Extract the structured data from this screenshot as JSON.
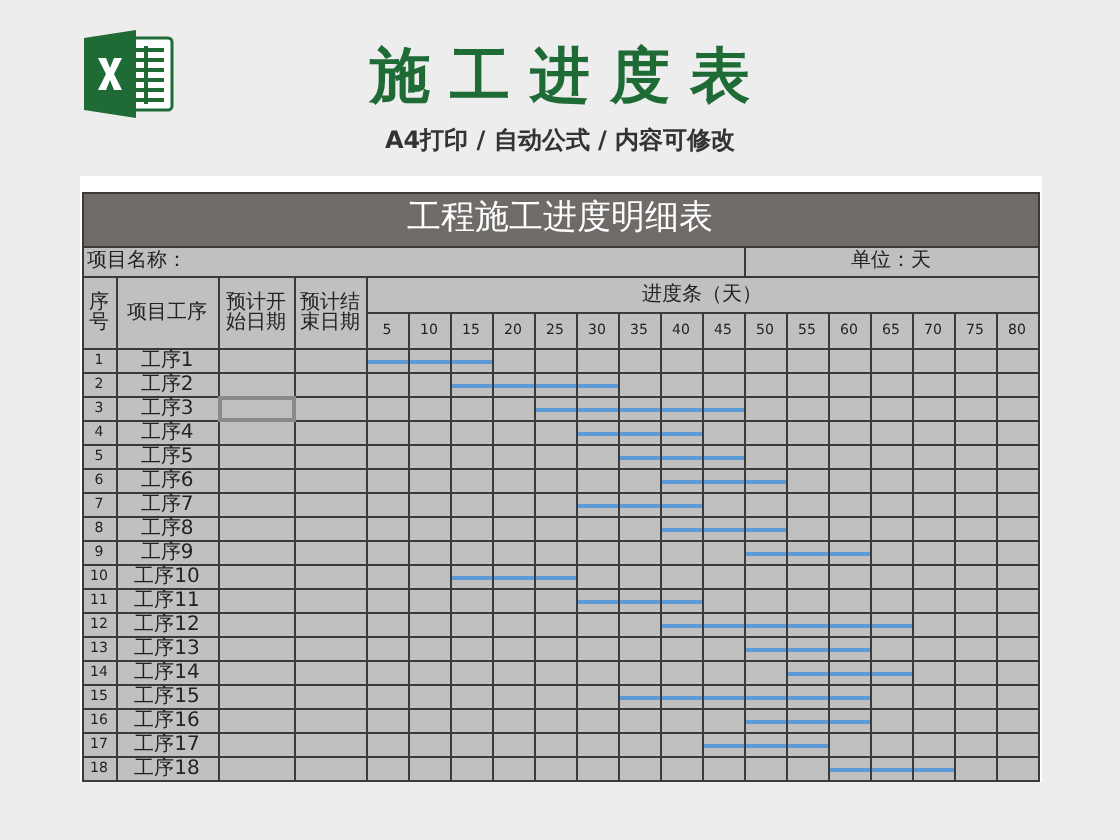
{
  "header": {
    "title": "施工进度表",
    "subtitle": "A4打印 / 自动公式 / 内容可修改"
  },
  "sheet": {
    "title": "工程施工进度明细表",
    "project_label": "项目名称：",
    "unit_label": "单位：天",
    "columns": [
      "序号",
      "项目工序",
      "预计开始日期",
      "预计结束日期"
    ],
    "progress_header": "进度条（天）",
    "day_columns": [
      "5",
      "10",
      "15",
      "20",
      "25",
      "30",
      "35",
      "40",
      "45",
      "50",
      "55",
      "60",
      "65",
      "70",
      "75",
      "80"
    ],
    "rows": [
      {
        "no": "1",
        "task": "工序1",
        "selected": false,
        "days": [
          {
            "filled": true
          },
          {
            "filled": true
          },
          {
            "filled": true
          },
          {
            "filled": false
          },
          {
            "filled": false
          },
          {
            "filled": false
          },
          {
            "filled": false
          },
          {
            "filled": false
          },
          {
            "filled": false
          },
          {
            "filled": false
          },
          {
            "filled": false
          },
          {
            "filled": false
          },
          {
            "filled": false
          },
          {
            "filled": false
          },
          {
            "filled": false
          },
          {
            "filled": false
          }
        ]
      },
      {
        "no": "2",
        "task": "工序2",
        "selected": false,
        "days": [
          {
            "filled": false
          },
          {
            "filled": false
          },
          {
            "filled": true
          },
          {
            "filled": true
          },
          {
            "filled": true
          },
          {
            "filled": true
          },
          {
            "filled": false
          },
          {
            "filled": false
          },
          {
            "filled": false
          },
          {
            "filled": false
          },
          {
            "filled": false
          },
          {
            "filled": false
          },
          {
            "filled": false
          },
          {
            "filled": false
          },
          {
            "filled": false
          },
          {
            "filled": false
          }
        ]
      },
      {
        "no": "3",
        "task": "工序3",
        "selected": true,
        "days": [
          {
            "filled": false
          },
          {
            "filled": false
          },
          {
            "filled": false
          },
          {
            "filled": false
          },
          {
            "filled": true
          },
          {
            "filled": true
          },
          {
            "filled": true
          },
          {
            "filled": true
          },
          {
            "filled": true
          },
          {
            "filled": false
          },
          {
            "filled": false
          },
          {
            "filled": false
          },
          {
            "filled": false
          },
          {
            "filled": false
          },
          {
            "filled": false
          },
          {
            "filled": false
          }
        ]
      },
      {
        "no": "4",
        "task": "工序4",
        "selected": false,
        "days": [
          {
            "filled": false
          },
          {
            "filled": false
          },
          {
            "filled": false
          },
          {
            "filled": false
          },
          {
            "filled": false
          },
          {
            "filled": true
          },
          {
            "filled": true
          },
          {
            "filled": true
          },
          {
            "filled": false
          },
          {
            "filled": false
          },
          {
            "filled": false
          },
          {
            "filled": false
          },
          {
            "filled": false
          },
          {
            "filled": false
          },
          {
            "filled": false
          },
          {
            "filled": false
          }
        ]
      },
      {
        "no": "5",
        "task": "工序5",
        "selected": false,
        "days": [
          {
            "filled": false
          },
          {
            "filled": false
          },
          {
            "filled": false
          },
          {
            "filled": false
          },
          {
            "filled": false
          },
          {
            "filled": false
          },
          {
            "filled": true
          },
          {
            "filled": true
          },
          {
            "filled": true
          },
          {
            "filled": false
          },
          {
            "filled": false
          },
          {
            "filled": false
          },
          {
            "filled": false
          },
          {
            "filled": false
          },
          {
            "filled": false
          },
          {
            "filled": false
          }
        ]
      },
      {
        "no": "6",
        "task": "工序6",
        "selected": false,
        "days": [
          {
            "filled": false
          },
          {
            "filled": false
          },
          {
            "filled": false
          },
          {
            "filled": false
          },
          {
            "filled": false
          },
          {
            "filled": false
          },
          {
            "filled": false
          },
          {
            "filled": true
          },
          {
            "filled": true
          },
          {
            "filled": true
          },
          {
            "filled": false
          },
          {
            "filled": false
          },
          {
            "filled": false
          },
          {
            "filled": false
          },
          {
            "filled": false
          },
          {
            "filled": false
          }
        ]
      },
      {
        "no": "7",
        "task": "工序7",
        "selected": false,
        "days": [
          {
            "filled": false
          },
          {
            "filled": false
          },
          {
            "filled": false
          },
          {
            "filled": false
          },
          {
            "filled": false
          },
          {
            "filled": true
          },
          {
            "filled": true
          },
          {
            "filled": true
          },
          {
            "filled": false
          },
          {
            "filled": false
          },
          {
            "filled": false
          },
          {
            "filled": false
          },
          {
            "filled": false
          },
          {
            "filled": false
          },
          {
            "filled": false
          },
          {
            "filled": false
          }
        ]
      },
      {
        "no": "8",
        "task": "工序8",
        "selected": false,
        "days": [
          {
            "filled": false
          },
          {
            "filled": false
          },
          {
            "filled": false
          },
          {
            "filled": false
          },
          {
            "filled": false
          },
          {
            "filled": false
          },
          {
            "filled": false
          },
          {
            "filled": true
          },
          {
            "filled": true
          },
          {
            "filled": true
          },
          {
            "filled": false
          },
          {
            "filled": false
          },
          {
            "filled": false
          },
          {
            "filled": false
          },
          {
            "filled": false
          },
          {
            "filled": false
          }
        ]
      },
      {
        "no": "9",
        "task": "工序9",
        "selected": false,
        "days": [
          {
            "filled": false
          },
          {
            "filled": false
          },
          {
            "filled": false
          },
          {
            "filled": false
          },
          {
            "filled": false
          },
          {
            "filled": false
          },
          {
            "filled": false
          },
          {
            "filled": false
          },
          {
            "filled": false
          },
          {
            "filled": true
          },
          {
            "filled": true
          },
          {
            "filled": true
          },
          {
            "filled": false
          },
          {
            "filled": false
          },
          {
            "filled": false
          },
          {
            "filled": false
          }
        ]
      },
      {
        "no": "10",
        "task": "工序10",
        "selected": false,
        "days": [
          {
            "filled": false
          },
          {
            "filled": false
          },
          {
            "filled": true
          },
          {
            "filled": true
          },
          {
            "filled": true
          },
          {
            "filled": false
          },
          {
            "filled": false
          },
          {
            "filled": false
          },
          {
            "filled": false
          },
          {
            "filled": false
          },
          {
            "filled": false
          },
          {
            "filled": false
          },
          {
            "filled": false
          },
          {
            "filled": false
          },
          {
            "filled": false
          },
          {
            "filled": false
          }
        ]
      },
      {
        "no": "11",
        "task": "工序11",
        "selected": false,
        "days": [
          {
            "filled": false
          },
          {
            "filled": false
          },
          {
            "filled": false
          },
          {
            "filled": false
          },
          {
            "filled": false
          },
          {
            "filled": true
          },
          {
            "filled": true
          },
          {
            "filled": true
          },
          {
            "filled": false
          },
          {
            "filled": false
          },
          {
            "filled": false
          },
          {
            "filled": false
          },
          {
            "filled": false
          },
          {
            "filled": false
          },
          {
            "filled": false
          },
          {
            "filled": false
          }
        ]
      },
      {
        "no": "12",
        "task": "工序12",
        "selected": false,
        "days": [
          {
            "filled": false
          },
          {
            "filled": false
          },
          {
            "filled": false
          },
          {
            "filled": false
          },
          {
            "filled": false
          },
          {
            "filled": false
          },
          {
            "filled": false
          },
          {
            "filled": true
          },
          {
            "filled": true
          },
          {
            "filled": true
          },
          {
            "filled": true
          },
          {
            "filled": true
          },
          {
            "filled": true
          },
          {
            "filled": false
          },
          {
            "filled": false
          },
          {
            "filled": false
          }
        ]
      },
      {
        "no": "13",
        "task": "工序13",
        "selected": false,
        "days": [
          {
            "filled": false
          },
          {
            "filled": false
          },
          {
            "filled": false
          },
          {
            "filled": false
          },
          {
            "filled": false
          },
          {
            "filled": false
          },
          {
            "filled": false
          },
          {
            "filled": false
          },
          {
            "filled": false
          },
          {
            "filled": true
          },
          {
            "filled": true
          },
          {
            "filled": true
          },
          {
            "filled": false
          },
          {
            "filled": false
          },
          {
            "filled": false
          },
          {
            "filled": false
          }
        ]
      },
      {
        "no": "14",
        "task": "工序14",
        "selected": false,
        "days": [
          {
            "filled": false
          },
          {
            "filled": false
          },
          {
            "filled": false
          },
          {
            "filled": false
          },
          {
            "filled": false
          },
          {
            "filled": false
          },
          {
            "filled": false
          },
          {
            "filled": false
          },
          {
            "filled": false
          },
          {
            "filled": false
          },
          {
            "filled": true
          },
          {
            "filled": true
          },
          {
            "filled": true
          },
          {
            "filled": false
          },
          {
            "filled": false
          },
          {
            "filled": false
          }
        ]
      },
      {
        "no": "15",
        "task": "工序15",
        "selected": false,
        "days": [
          {
            "filled": false
          },
          {
            "filled": false
          },
          {
            "filled": false
          },
          {
            "filled": false
          },
          {
            "filled": false
          },
          {
            "filled": false
          },
          {
            "filled": true
          },
          {
            "filled": true
          },
          {
            "filled": true
          },
          {
            "filled": true
          },
          {
            "filled": true
          },
          {
            "filled": true
          },
          {
            "filled": false
          },
          {
            "filled": false
          },
          {
            "filled": false
          },
          {
            "filled": false
          }
        ]
      },
      {
        "no": "16",
        "task": "工序16",
        "selected": false,
        "days": [
          {
            "filled": false
          },
          {
            "filled": false
          },
          {
            "filled": false
          },
          {
            "filled": false
          },
          {
            "filled": false
          },
          {
            "filled": false
          },
          {
            "filled": false
          },
          {
            "filled": false
          },
          {
            "filled": false
          },
          {
            "filled": true
          },
          {
            "filled": true
          },
          {
            "filled": true
          },
          {
            "filled": false
          },
          {
            "filled": false
          },
          {
            "filled": false
          },
          {
            "filled": false
          }
        ]
      },
      {
        "no": "17",
        "task": "工序17",
        "selected": false,
        "days": [
          {
            "filled": false
          },
          {
            "filled": false
          },
          {
            "filled": false
          },
          {
            "filled": false
          },
          {
            "filled": false
          },
          {
            "filled": false
          },
          {
            "filled": false
          },
          {
            "filled": false
          },
          {
            "filled": true
          },
          {
            "filled": true
          },
          {
            "filled": true
          },
          {
            "filled": false
          },
          {
            "filled": false
          },
          {
            "filled": false
          },
          {
            "filled": false
          },
          {
            "filled": false
          }
        ]
      },
      {
        "no": "18",
        "task": "工序18",
        "selected": false,
        "days": [
          {
            "filled": false
          },
          {
            "filled": false
          },
          {
            "filled": false
          },
          {
            "filled": false
          },
          {
            "filled": false
          },
          {
            "filled": false
          },
          {
            "filled": false
          },
          {
            "filled": false
          },
          {
            "filled": false
          },
          {
            "filled": false
          },
          {
            "filled": false
          },
          {
            "filled": true
          },
          {
            "filled": true
          },
          {
            "filled": true
          },
          {
            "filled": false
          },
          {
            "filled": false
          }
        ]
      }
    ]
  }
}
